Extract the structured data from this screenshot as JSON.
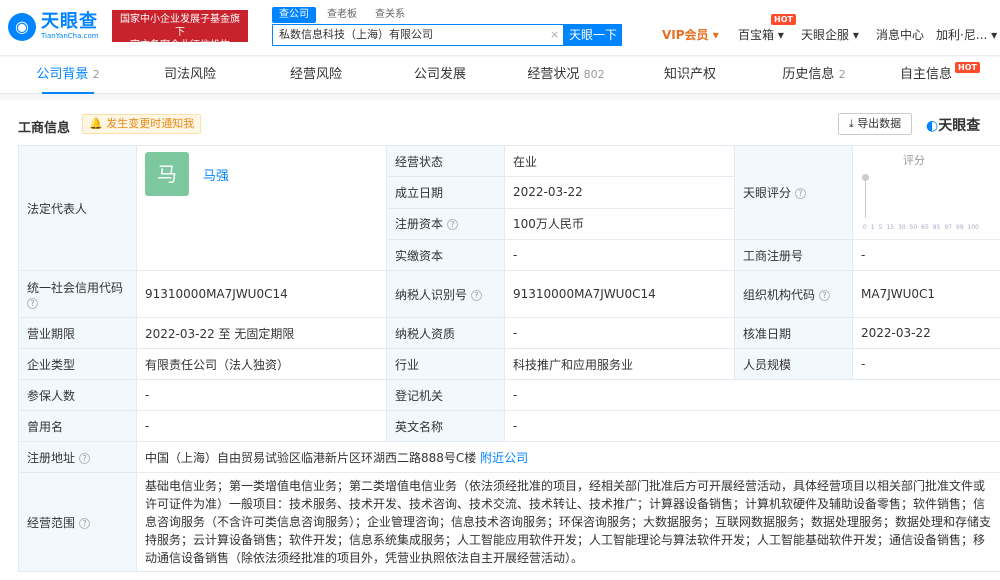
{
  "header": {
    "logo_main": "天眼查",
    "logo_sub": "TianYanCha.com",
    "gov_line1": "国家中小企业发展子基金旗下",
    "gov_line2": "官方备案企业征信机构",
    "search_tabs": [
      "查公司",
      "查老板",
      "查关系"
    ],
    "search_value": "私数信息科技（上海）有限公司",
    "search_clear": "×",
    "search_button": "天眼一下",
    "vip": "VIP会员",
    "baibao": "百宝箱",
    "qiban": "天眼企服",
    "message": "消息中心",
    "user": "加利·尼...",
    "hot": "HOT"
  },
  "tabs": [
    {
      "label": "公司背景",
      "count": "2"
    },
    {
      "label": "司法风险",
      "count": ""
    },
    {
      "label": "经营风险",
      "count": ""
    },
    {
      "label": "公司发展",
      "count": ""
    },
    {
      "label": "经营状况",
      "count": "802"
    },
    {
      "label": "知识产权",
      "count": ""
    },
    {
      "label": "历史信息",
      "count": "2"
    },
    {
      "label": "自主信息",
      "count": ""
    }
  ],
  "section": {
    "title": "工商信息",
    "notify": "发生变更时通知我",
    "export": "导出数据",
    "brand_a": "天眼查"
  },
  "info": {
    "legal_rep_label": "法定代表人",
    "avatar_char": "马",
    "legal_rep_name": "马强",
    "status_label": "经营状态",
    "status": "在业",
    "found_label": "成立日期",
    "found": "2022-03-22",
    "capital_label": "注册资本",
    "capital": "100万人民币",
    "paid_label": "实缴资本",
    "paid": "-",
    "score_label": "天眼评分",
    "score_title": "评分",
    "score_axis": [
      "0",
      "1",
      "5",
      "15",
      "30",
      "50",
      "65",
      "85",
      "97",
      "99",
      "100"
    ],
    "reg_no_label": "工商注册号",
    "reg_no": "-",
    "credit_label": "统一社会信用代码",
    "credit": "91310000MA7JWU0C14",
    "taxpayer_label": "纳税人识别号",
    "taxpayer": "91310000MA7JWU0C14",
    "org_label": "组织机构代码",
    "org": "MA7JWU0C1",
    "term_label": "营业期限",
    "term": "2022-03-22 至 无固定期限",
    "qual_label": "纳税人资质",
    "qual": "-",
    "approve_label": "核准日期",
    "approve": "2022-03-22",
    "type_label": "企业类型",
    "type": "有限责任公司（法人独资）",
    "industry_label": "行业",
    "industry": "科技推广和应用服务业",
    "size_label": "人员规模",
    "size": "-",
    "insured_label": "参保人数",
    "insured": "-",
    "authority_label": "登记机关",
    "authority": "-",
    "former_label": "曾用名",
    "former": "-",
    "english_label": "英文名称",
    "english": "-",
    "address_label": "注册地址",
    "address": "中国（上海）自由贸易试验区临港新片区环湖西二路888号C楼",
    "nearby": "附近公司",
    "scope_label": "经营范围",
    "scope": "基础电信业务；第一类增值电信业务；第二类增值电信业务（依法须经批准的项目，经相关部门批准后方可开展经营活动，具体经营项目以相关部门批准文件或许可证件为准）一般项目：技术服务、技术开发、技术咨询、技术交流、技术转让、技术推广；计算器设备销售；计算机软硬件及辅助设备零售；软件销售；信息咨询服务（不含许可类信息咨询服务）；企业管理咨询；信息技术咨询服务；环保咨询服务；大数据服务；互联网数据服务；数据处理服务；数据处理和存储支持服务；云计算设备销售；软件开发；信息系统集成服务；人工智能应用软件开发；人工智能理论与算法软件开发；人工智能基础软件开发；通信设备销售；移动通信设备销售（除依法须经批准的项目外，凭营业执照依法自主开展经营活动）。"
  }
}
